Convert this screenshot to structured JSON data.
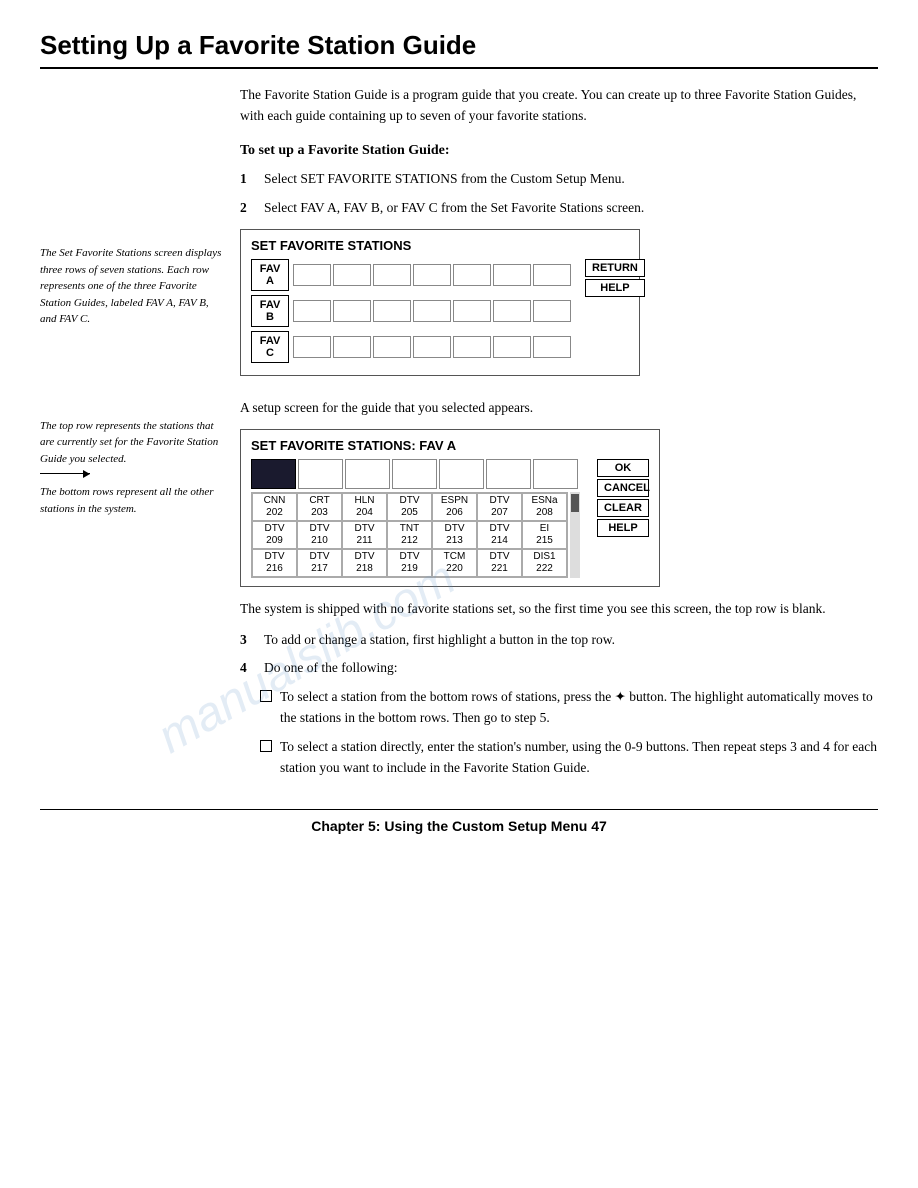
{
  "page": {
    "title": "Setting Up a Favorite Station Guide"
  },
  "intro": {
    "paragraph": "The Favorite Station Guide is a program guide that you create. You can create up to three Favorite Station Guides, with each guide containing up to seven of your favorite stations."
  },
  "setup_heading": "To set up a Favorite Station Guide:",
  "steps": [
    {
      "num": "1",
      "text": "Select SET FAVORITE STATIONS from the Custom Setup Menu."
    },
    {
      "num": "2",
      "text": "Select FAV A, FAV B, or FAV C from the Set Favorite Stations screen."
    }
  ],
  "fav_stations_box": {
    "title": "SET FAVORITE STATIONS",
    "rows": [
      {
        "label": "FAV A",
        "cells": 7
      },
      {
        "label": "FAV B",
        "cells": 7
      },
      {
        "label": "FAV C",
        "cells": 7
      }
    ],
    "buttons": [
      "RETURN",
      "HELP"
    ]
  },
  "setup_appears": "A setup screen for the guide that you selected appears.",
  "fav_a_box": {
    "title": "SET FAVORITE STATIONS: FAV A",
    "top_row_cells": 7,
    "buttons": [
      "OK",
      "CANCEL",
      "CLEAR",
      "HELP"
    ],
    "station_rows": [
      [
        {
          "line1": "CNN",
          "line2": "202"
        },
        {
          "line1": "CRT",
          "line2": "203"
        },
        {
          "line1": "HLN",
          "line2": "204"
        },
        {
          "line1": "DTV",
          "line2": "205"
        },
        {
          "line1": "ESPN",
          "line2": "206"
        },
        {
          "line1": "DTV",
          "line2": "207"
        },
        {
          "line1": "ESNa",
          "line2": "208"
        }
      ],
      [
        {
          "line1": "DTV",
          "line2": "209"
        },
        {
          "line1": "DTV",
          "line2": "210"
        },
        {
          "line1": "DTV",
          "line2": "211"
        },
        {
          "line1": "TNT",
          "line2": "212"
        },
        {
          "line1": "DTV",
          "line2": "213"
        },
        {
          "line1": "DTV",
          "line2": "214"
        },
        {
          "line1": "EI",
          "line2": "215"
        }
      ],
      [
        {
          "line1": "DTV",
          "line2": "216"
        },
        {
          "line1": "DTV",
          "line2": "217"
        },
        {
          "line1": "DTV",
          "line2": "218"
        },
        {
          "line1": "DTV",
          "line2": "219"
        },
        {
          "line1": "TCM",
          "line2": "220"
        },
        {
          "line1": "DTV",
          "line2": "221"
        },
        {
          "line1": "DIS1",
          "line2": "222"
        }
      ]
    ]
  },
  "caption_left_top": "The Set Favorite Stations screen displays three rows of seven stations. Each row represents one of the three Favorite Station Guides, labeled FAV A, FAV B, and FAV C.",
  "caption_left_mid1": "The top row represents the stations that are currently set for the Favorite Station Guide you selected.",
  "caption_left_mid2": "The bottom rows represent all the other stations in the system.",
  "shipped_text": "The system is shipped with no favorite stations set, so the first time you see this screen, the top row is blank.",
  "step3": {
    "num": "3",
    "text": "To add or change a station, first highlight a button in the top row."
  },
  "step4": {
    "num": "4",
    "text": "Do one of the following:"
  },
  "sub_steps": [
    {
      "text": "To select a station from the bottom rows of stations, press the ✦ button. The highlight automatically moves to the stations in the bottom rows. Then go to step 5."
    },
    {
      "text": "To select a station directly, enter the station's number, using the 0-9 buttons. Then repeat steps 3 and 4 for each station you want to include in the Favorite Station Guide."
    }
  ],
  "footer": {
    "text": "Chapter 5: Using the Custom Setup Menu   47"
  }
}
